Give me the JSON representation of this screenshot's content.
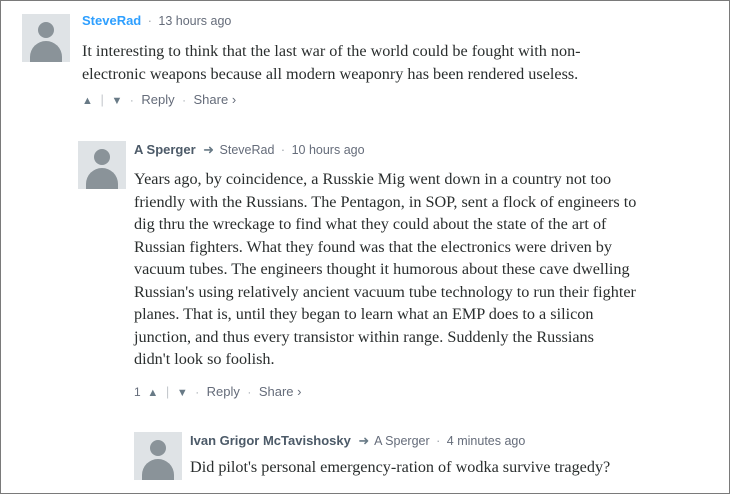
{
  "comments": [
    {
      "author": "SteveRad",
      "separator": "·",
      "time": "13 hours ago",
      "lines": [
        "It interesting to think that the last war of the world could be fought with non-",
        "electronic weapons because all modern weaponry has been rendered useless."
      ],
      "actions": {
        "upvote": "^",
        "downvote": "v",
        "reply": "Reply",
        "share": "Share ›"
      }
    },
    {
      "author": "A Sperger",
      "reply_to": "SteveRad",
      "separator": "·",
      "time": "10 hours ago",
      "lines": [
        "Years ago, by coincidence, a Russkie Mig went down in a country not too",
        "friendly with the Russians. The Pentagon, in SOP, sent a flock of engineers to",
        "dig thru the wreckage to find what they could about the state of the art of",
        "Russian fighters. What they found was that the electronics were driven by",
        "vacuum tubes. The engineers thought it humorous about these cave dwelling",
        "Russian's using relatively ancient vacuum tube technology to run their fighter",
        "planes. That is, until they began to learn what an EMP does to a silicon",
        "junction, and thus every transistor within range. Suddenly the Russians",
        "didn't look so foolish."
      ],
      "actions": {
        "vote_count": "1",
        "upvote": "^",
        "downvote": "v",
        "reply": "Reply",
        "share": "Share ›"
      }
    },
    {
      "author": "Ivan Grigor McTavishosky",
      "reply_to": "A Sperger",
      "separator": "·",
      "time": "4 minutes ago",
      "lines": [
        "Did pilot's personal emergency-ration of wodka survive tragedy?"
      ]
    }
  ],
  "icons": {
    "avatar": "avatar-placeholder-icon",
    "reply_arrow": "reply-arrow-icon",
    "upvote": "chevron-up-icon",
    "downvote": "chevron-down-icon"
  },
  "colors": {
    "author_link": "#2e9fff",
    "author_dark": "#4c5a68",
    "meta_text": "#656c7a",
    "body_text": "#2a2e2e",
    "avatar_bg": "#dfe3e6",
    "avatar_fg": "#8a9399"
  }
}
